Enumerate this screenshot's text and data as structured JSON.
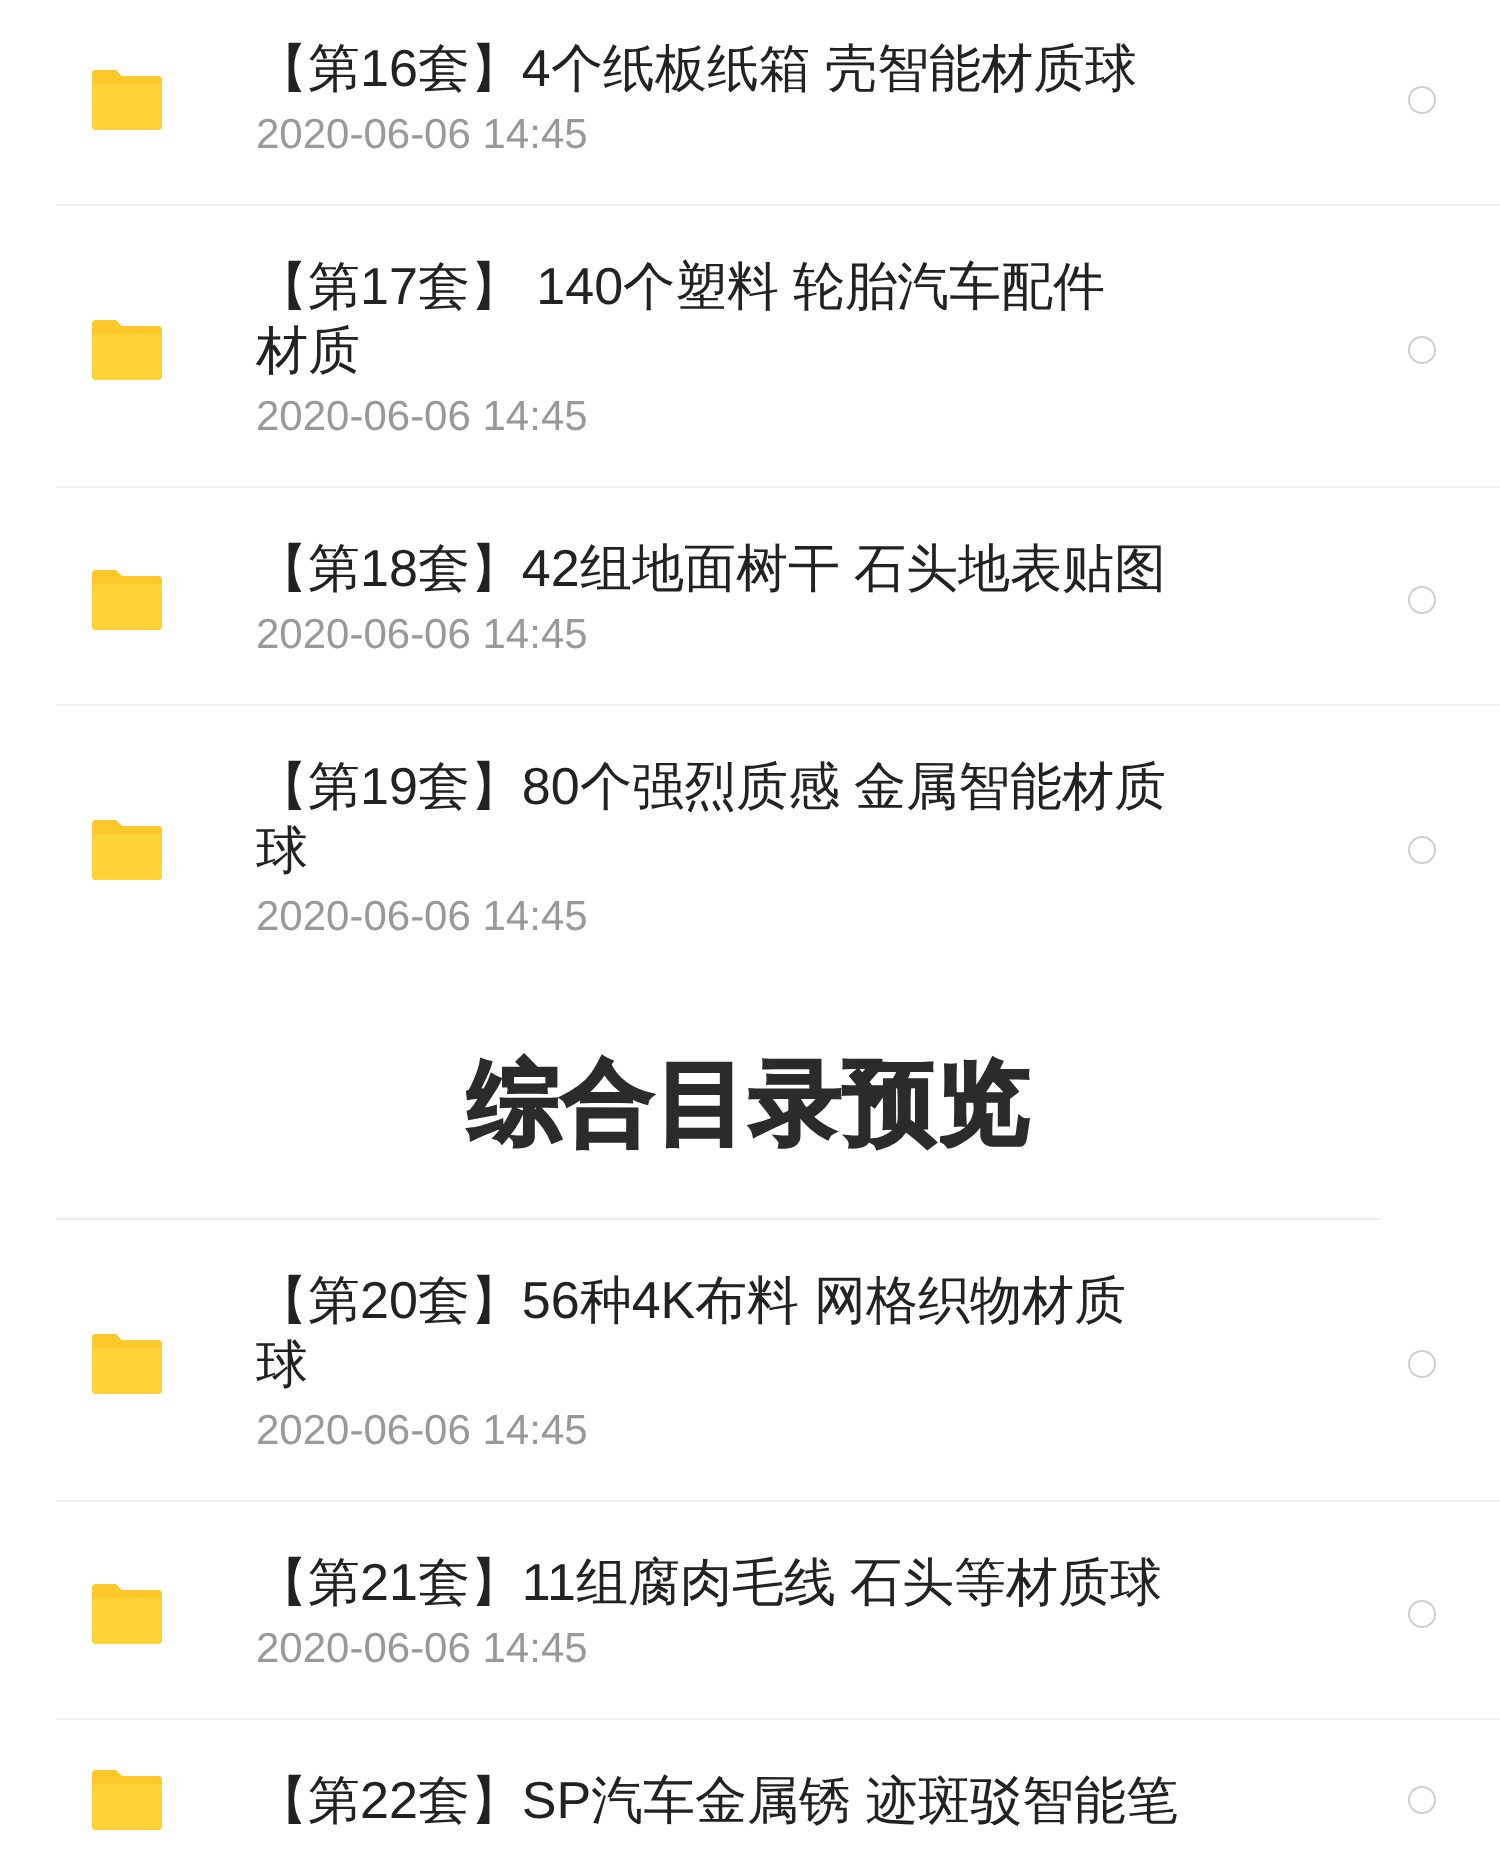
{
  "file_lists": [
    {
      "items": [
        {
          "title": [
            "【第16套】4个纸板纸箱 壳智能材质球"
          ],
          "date": "2020-06-06 14:45",
          "selected": false
        },
        {
          "title": [
            "【第17套】 140个塑料 轮胎汽车配件",
            "材质"
          ],
          "date": "2020-06-06 14:45",
          "selected": false
        },
        {
          "title": [
            "【第18套】42组地面树干 石头地表贴图"
          ],
          "date": "2020-06-06 14:45",
          "selected": false
        },
        {
          "title": [
            "【第19套】80个强烈质感 金属智能材质",
            "球"
          ],
          "date": "2020-06-06 14:45",
          "selected": false
        }
      ]
    },
    {
      "heading": "综合目录预览",
      "items": [
        {
          "title": [
            "【第20套】56种4K布料 网格织物材质",
            "球"
          ],
          "date": "2020-06-06 14:45",
          "selected": false
        },
        {
          "title": [
            "【第21套】11组腐肉毛线 石头等材质球"
          ],
          "date": "2020-06-06 14:45",
          "selected": false
        },
        {
          "title": [
            "【第22套】SP汽车金属锈 迹斑驳智能笔"
          ],
          "selected": false
        }
      ]
    }
  ]
}
